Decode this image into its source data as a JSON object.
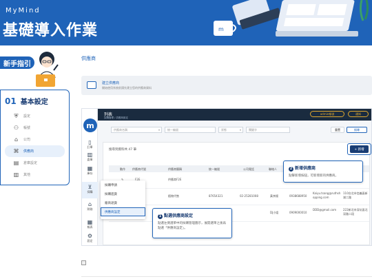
{
  "header": {
    "brand": "MyMind",
    "title": "基礎導入作業",
    "accent_color": "#1f63b8"
  },
  "sidebar": {
    "guide_label": "新手指引",
    "section_number": "01",
    "section_title": "基本設定",
    "items": [
      {
        "icon": "shield-icon",
        "label": "設定",
        "active": false
      },
      {
        "icon": "users-icon",
        "label": "帳號",
        "active": false
      },
      {
        "icon": "building-icon",
        "label": "公司",
        "active": false
      },
      {
        "icon": "store-icon",
        "label": "供應商",
        "active": true
      },
      {
        "icon": "warehouse-icon",
        "label": "倉庫設定",
        "active": false
      },
      {
        "icon": "chart-icon",
        "label": "其他",
        "active": false
      }
    ]
  },
  "content": {
    "breadcrumb": "供應商",
    "info_title": "建立供應商",
    "info_subtitle": "開始使用系統前請先建立您的供應商資料"
  },
  "screenshot": {
    "page_title": "列表",
    "page_crumb": "採購管理 / 供應商設定",
    "user_label": "admin帳號",
    "notif_label": "通知",
    "rail": [
      {
        "glyph": "📄",
        "label": "訂單"
      },
      {
        "glyph": "🏢",
        "label": "倉庫"
      },
      {
        "glyph": "⊞",
        "label": "庫存"
      },
      {
        "glyph": "🛒",
        "label": "採購",
        "selected": true
      },
      {
        "glyph": "🏛",
        "label": "財務"
      },
      {
        "glyph": "▦",
        "label": "報表"
      },
      {
        "glyph": "⚙",
        "label": "設定"
      }
    ],
    "filters": {
      "f1": "供應商名稱",
      "f2": "統一編號",
      "f3": "狀態",
      "f4": "關鍵字",
      "reset": "重置",
      "search": "搜尋"
    },
    "result_text": "搜尋到資料共 47 筆",
    "add_button": "+ 新增",
    "columns": [
      "動作",
      "供應商代號",
      "供應商簡稱",
      "統一編號",
      "公司電話",
      "聯絡人",
      "聯絡電話",
      "Email",
      "地址"
    ],
    "rows": [
      {
        "code": "F2E",
        "name": "供應商F2E",
        "tax": "",
        "phone": "",
        "contact": "",
        "mobile": "",
        "email": "",
        "addr": ""
      },
      {
        "code": "002",
        "name": "植物代售",
        "tax": "87654321",
        "phone": "02-25281008",
        "contact": "黃李揚",
        "mobile": "0938688950",
        "email": "Kaiyu.tsang@ruthshopping.com",
        "addr": "110台北市信義區新湖二路"
      },
      {
        "code": "",
        "name": "",
        "tax": "",
        "phone": "",
        "contact": "DJ小姐",
        "mobile": "0909000010",
        "email": "DDD@gmail.com",
        "addr": "222新北市深坑區北深路二段"
      }
    ]
  },
  "menu": {
    "items": [
      "採購申請",
      "採購進貨",
      "廠商退貨",
      "供應商設定"
    ]
  },
  "callouts": {
    "c1_num": "1",
    "c1_title": "點選供應商設定",
    "c1_desc": "點選左側選單中的採購管理圖示，展開選單之後再點選「供應商設定」。",
    "c2_num": "2",
    "c2_title": "新增供應商",
    "c2_desc": "點擊新增按鈕，可新增新的供應商。"
  }
}
